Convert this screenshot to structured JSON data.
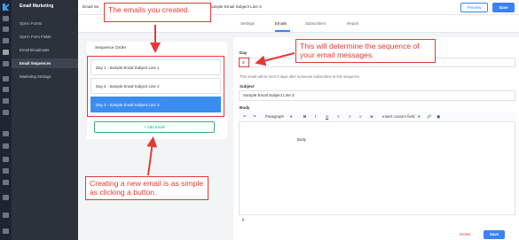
{
  "app": {
    "sidebar_title": "Email Marketing",
    "nav_items": [
      {
        "label": "Opt-in Forms"
      },
      {
        "label": "Opt-in Form Fields"
      },
      {
        "label": "Email Broadcasts"
      },
      {
        "label": "Email Sequences",
        "active": true
      },
      {
        "label": "Marketing Settings"
      }
    ],
    "rail_icons": [
      "home-icon",
      "email-icon",
      "users-icon",
      "chart-icon",
      "settings-icon",
      "layers-icon",
      "grid-icon",
      "store-icon",
      "list-icon",
      "help-icon",
      "gear-icon"
    ]
  },
  "topbar": {
    "crumb": "Email Se",
    "crumb_subject": "Sample Email Subject Line 3",
    "preview_label": "Preview",
    "save_label": "Save"
  },
  "tabs": [
    "Settings",
    "Emails",
    "Subscribers",
    "Report"
  ],
  "sequence": {
    "title": "Sequence Order",
    "items": [
      "Day 1 - Sample Email Subject Line 1",
      "Day 2 - Sample Email Subject Line 2",
      "Day 3 - Sample Email Subject Line 3"
    ],
    "add_label": "+ Add Email"
  },
  "editor": {
    "day_label": "Day",
    "day_value": "3",
    "help_text": "This email will be sent 3 days after someone subscribes to this sequence.",
    "subject_label": "Subject",
    "subject_value": "Sample Email Subject Line 3",
    "body_label": "Body",
    "paragraph_label": "Paragraph",
    "custom_field_label": "Insert custom field",
    "body_text": "Body",
    "status_path": "p",
    "delete_label": "Delete",
    "save_label": "Save"
  },
  "callouts": {
    "c1": "The emails you created.",
    "c2": "This will determine the sequence of your email messages.",
    "c3": "Creating a new email is as simple as clicking a button."
  },
  "colors": {
    "accent": "#3b82f6",
    "callout": "#e53935",
    "add_button": "#3bb273",
    "sidebar": "#2b323c"
  }
}
